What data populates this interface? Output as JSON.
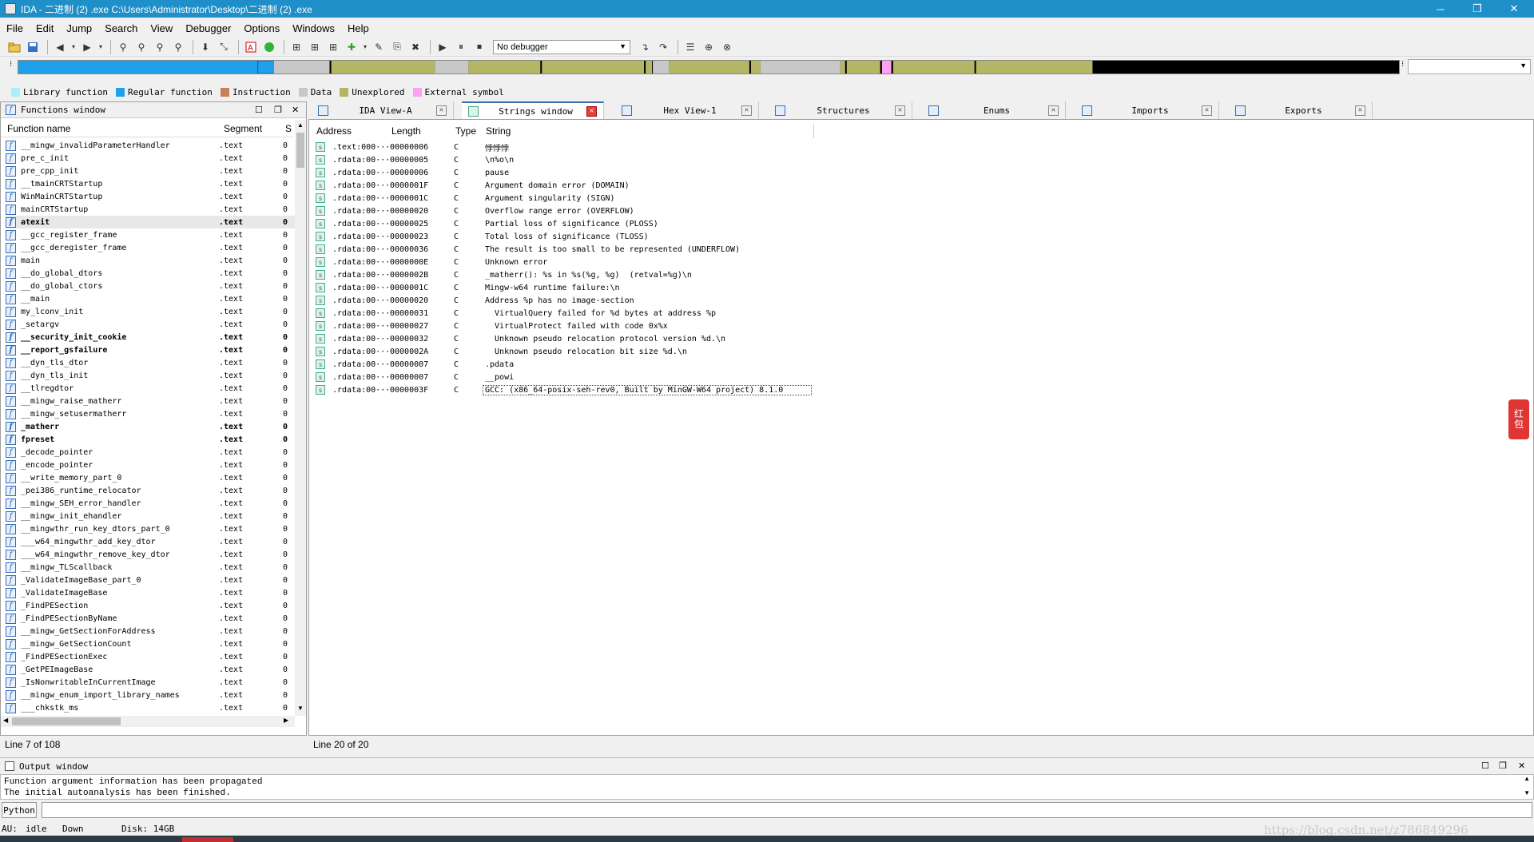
{
  "app": {
    "title": "IDA - 二进制 (2) .exe C:\\Users\\Administrator\\Desktop\\二进制 (2) .exe",
    "minimize": "─",
    "maximize": "❐",
    "close": "✕"
  },
  "menu": [
    "File",
    "Edit",
    "Jump",
    "Search",
    "View",
    "Debugger",
    "Options",
    "Windows",
    "Help"
  ],
  "toolbar": {
    "debugger": "No debugger"
  },
  "legend": [
    {
      "label": "Library function",
      "color": "#a8f0ff"
    },
    {
      "label": "Regular function",
      "color": "#1fa0e8"
    },
    {
      "label": "Instruction",
      "color": "#c8805a"
    },
    {
      "label": "Data",
      "color": "#c8c8c8"
    },
    {
      "label": "Unexplored",
      "color": "#b5b566"
    },
    {
      "label": "External symbol",
      "color": "#ffa0f0"
    }
  ],
  "functions": {
    "title": "Functions window",
    "headers": {
      "name": "Function name",
      "segment": "Segment",
      "s": "S"
    },
    "rows": [
      {
        "name": "__mingw_invalidParameterHandler",
        "seg": ".text",
        "c": "0",
        "bold": false
      },
      {
        "name": "pre_c_init",
        "seg": ".text",
        "c": "0",
        "bold": false
      },
      {
        "name": "pre_cpp_init",
        "seg": ".text",
        "c": "0",
        "bold": false
      },
      {
        "name": "__tmainCRTStartup",
        "seg": ".text",
        "c": "0",
        "bold": false
      },
      {
        "name": "WinMainCRTStartup",
        "seg": ".text",
        "c": "0",
        "bold": false
      },
      {
        "name": "mainCRTStartup",
        "seg": ".text",
        "c": "0",
        "bold": false
      },
      {
        "name": "atexit",
        "seg": ".text",
        "c": "0",
        "bold": true
      },
      {
        "name": "__gcc_register_frame",
        "seg": ".text",
        "c": "0",
        "bold": false
      },
      {
        "name": "__gcc_deregister_frame",
        "seg": ".text",
        "c": "0",
        "bold": false
      },
      {
        "name": "main",
        "seg": ".text",
        "c": "0",
        "bold": false
      },
      {
        "name": "__do_global_dtors",
        "seg": ".text",
        "c": "0",
        "bold": false
      },
      {
        "name": "__do_global_ctors",
        "seg": ".text",
        "c": "0",
        "bold": false
      },
      {
        "name": "__main",
        "seg": ".text",
        "c": "0",
        "bold": false
      },
      {
        "name": "my_lconv_init",
        "seg": ".text",
        "c": "0",
        "bold": false
      },
      {
        "name": "_setargv",
        "seg": ".text",
        "c": "0",
        "bold": false
      },
      {
        "name": "__security_init_cookie",
        "seg": ".text",
        "c": "0",
        "bold": true
      },
      {
        "name": "__report_gsfailure",
        "seg": ".text",
        "c": "0",
        "bold": true
      },
      {
        "name": "__dyn_tls_dtor",
        "seg": ".text",
        "c": "0",
        "bold": false
      },
      {
        "name": "__dyn_tls_init",
        "seg": ".text",
        "c": "0",
        "bold": false
      },
      {
        "name": "__tlregdtor",
        "seg": ".text",
        "c": "0",
        "bold": false
      },
      {
        "name": "__mingw_raise_matherr",
        "seg": ".text",
        "c": "0",
        "bold": false
      },
      {
        "name": "__mingw_setusermatherr",
        "seg": ".text",
        "c": "0",
        "bold": false
      },
      {
        "name": "_matherr",
        "seg": ".text",
        "c": "0",
        "bold": true
      },
      {
        "name": "fpreset",
        "seg": ".text",
        "c": "0",
        "bold": true
      },
      {
        "name": "_decode_pointer",
        "seg": ".text",
        "c": "0",
        "bold": false
      },
      {
        "name": "_encode_pointer",
        "seg": ".text",
        "c": "0",
        "bold": false
      },
      {
        "name": "__write_memory_part_0",
        "seg": ".text",
        "c": "0",
        "bold": false
      },
      {
        "name": "_pei386_runtime_relocator",
        "seg": ".text",
        "c": "0",
        "bold": false
      },
      {
        "name": "__mingw_SEH_error_handler",
        "seg": ".text",
        "c": "0",
        "bold": false
      },
      {
        "name": "__mingw_init_ehandler",
        "seg": ".text",
        "c": "0",
        "bold": false
      },
      {
        "name": "__mingwthr_run_key_dtors_part_0",
        "seg": ".text",
        "c": "0",
        "bold": false
      },
      {
        "name": "___w64_mingwthr_add_key_dtor",
        "seg": ".text",
        "c": "0",
        "bold": false
      },
      {
        "name": "___w64_mingwthr_remove_key_dtor",
        "seg": ".text",
        "c": "0",
        "bold": false
      },
      {
        "name": "__mingw_TLScallback",
        "seg": ".text",
        "c": "0",
        "bold": false
      },
      {
        "name": "_ValidateImageBase_part_0",
        "seg": ".text",
        "c": "0",
        "bold": false
      },
      {
        "name": "_ValidateImageBase",
        "seg": ".text",
        "c": "0",
        "bold": false
      },
      {
        "name": "_FindPESection",
        "seg": ".text",
        "c": "0",
        "bold": false
      },
      {
        "name": "_FindPESectionByName",
        "seg": ".text",
        "c": "0",
        "bold": false
      },
      {
        "name": "__mingw_GetSectionForAddress",
        "seg": ".text",
        "c": "0",
        "bold": false
      },
      {
        "name": "__mingw_GetSectionCount",
        "seg": ".text",
        "c": "0",
        "bold": false
      },
      {
        "name": "_FindPESectionExec",
        "seg": ".text",
        "c": "0",
        "bold": false
      },
      {
        "name": "_GetPEImageBase",
        "seg": ".text",
        "c": "0",
        "bold": false
      },
      {
        "name": "_IsNonwritableInCurrentImage",
        "seg": ".text",
        "c": "0",
        "bold": false
      },
      {
        "name": "__mingw_enum_import_library_names",
        "seg": ".text",
        "c": "0",
        "bold": false
      },
      {
        "name": "___chkstk_ms",
        "seg": ".text",
        "c": "0",
        "bold": false
      }
    ],
    "status": "Line 7 of 108"
  },
  "tabs": [
    "IDA View-A",
    "Strings window",
    "Hex View-1",
    "Structures",
    "Enums",
    "Imports",
    "Exports"
  ],
  "strings": {
    "headers": {
      "address": "Address",
      "length": "Length",
      "type": "Type",
      "string": "String"
    },
    "rows": [
      {
        "addr": ".text:000···",
        "len": "00000006",
        "type": "C",
        "str": "悖悖悖"
      },
      {
        "addr": ".rdata:00···",
        "len": "00000005",
        "type": "C",
        "str": "\\n%o\\n"
      },
      {
        "addr": ".rdata:00···",
        "len": "00000006",
        "type": "C",
        "str": "pause"
      },
      {
        "addr": ".rdata:00···",
        "len": "0000001F",
        "type": "C",
        "str": "Argument domain error (DOMAIN)"
      },
      {
        "addr": ".rdata:00···",
        "len": "0000001C",
        "type": "C",
        "str": "Argument singularity (SIGN)"
      },
      {
        "addr": ".rdata:00···",
        "len": "00000020",
        "type": "C",
        "str": "Overflow range error (OVERFLOW)"
      },
      {
        "addr": ".rdata:00···",
        "len": "00000025",
        "type": "C",
        "str": "Partial loss of significance (PLOSS)"
      },
      {
        "addr": ".rdata:00···",
        "len": "00000023",
        "type": "C",
        "str": "Total loss of significance (TLOSS)"
      },
      {
        "addr": ".rdata:00···",
        "len": "00000036",
        "type": "C",
        "str": "The result is too small to be represented (UNDERFLOW)"
      },
      {
        "addr": ".rdata:00···",
        "len": "0000000E",
        "type": "C",
        "str": "Unknown error"
      },
      {
        "addr": ".rdata:00···",
        "len": "0000002B",
        "type": "C",
        "str": "_matherr(): %s in %s(%g, %g)  (retval=%g)\\n"
      },
      {
        "addr": ".rdata:00···",
        "len": "0000001C",
        "type": "C",
        "str": "Mingw-w64 runtime failure:\\n"
      },
      {
        "addr": ".rdata:00···",
        "len": "00000020",
        "type": "C",
        "str": "Address %p has no image-section"
      },
      {
        "addr": ".rdata:00···",
        "len": "00000031",
        "type": "C",
        "str": "  VirtualQuery failed for %d bytes at address %p"
      },
      {
        "addr": ".rdata:00···",
        "len": "00000027",
        "type": "C",
        "str": "  VirtualProtect failed with code 0x%x"
      },
      {
        "addr": ".rdata:00···",
        "len": "00000032",
        "type": "C",
        "str": "  Unknown pseudo relocation protocol version %d.\\n"
      },
      {
        "addr": ".rdata:00···",
        "len": "0000002A",
        "type": "C",
        "str": "  Unknown pseudo relocation bit size %d.\\n"
      },
      {
        "addr": ".rdata:00···",
        "len": "00000007",
        "type": "C",
        "str": ".pdata"
      },
      {
        "addr": ".rdata:00···",
        "len": "00000007",
        "type": "C",
        "str": "__powi"
      },
      {
        "addr": ".rdata:00···",
        "len": "0000003F",
        "type": "C",
        "str": "GCC: (x86_64-posix-seh-rev0, Built by MinGW-W64 project) 8.1.0"
      }
    ],
    "status": "Line 20 of 20"
  },
  "output": {
    "title": "Output window",
    "lines": [
      "Function argument information has been propagated",
      "The initial autoanalysis has been finished."
    ],
    "python_btn": "Python"
  },
  "statusbar": {
    "au": "AU:",
    "state": "idle",
    "dir": "Down",
    "disk": "Disk: 14GB"
  },
  "side_badge": "红包",
  "watermark": "https://blog.csdn.net/z786849296"
}
